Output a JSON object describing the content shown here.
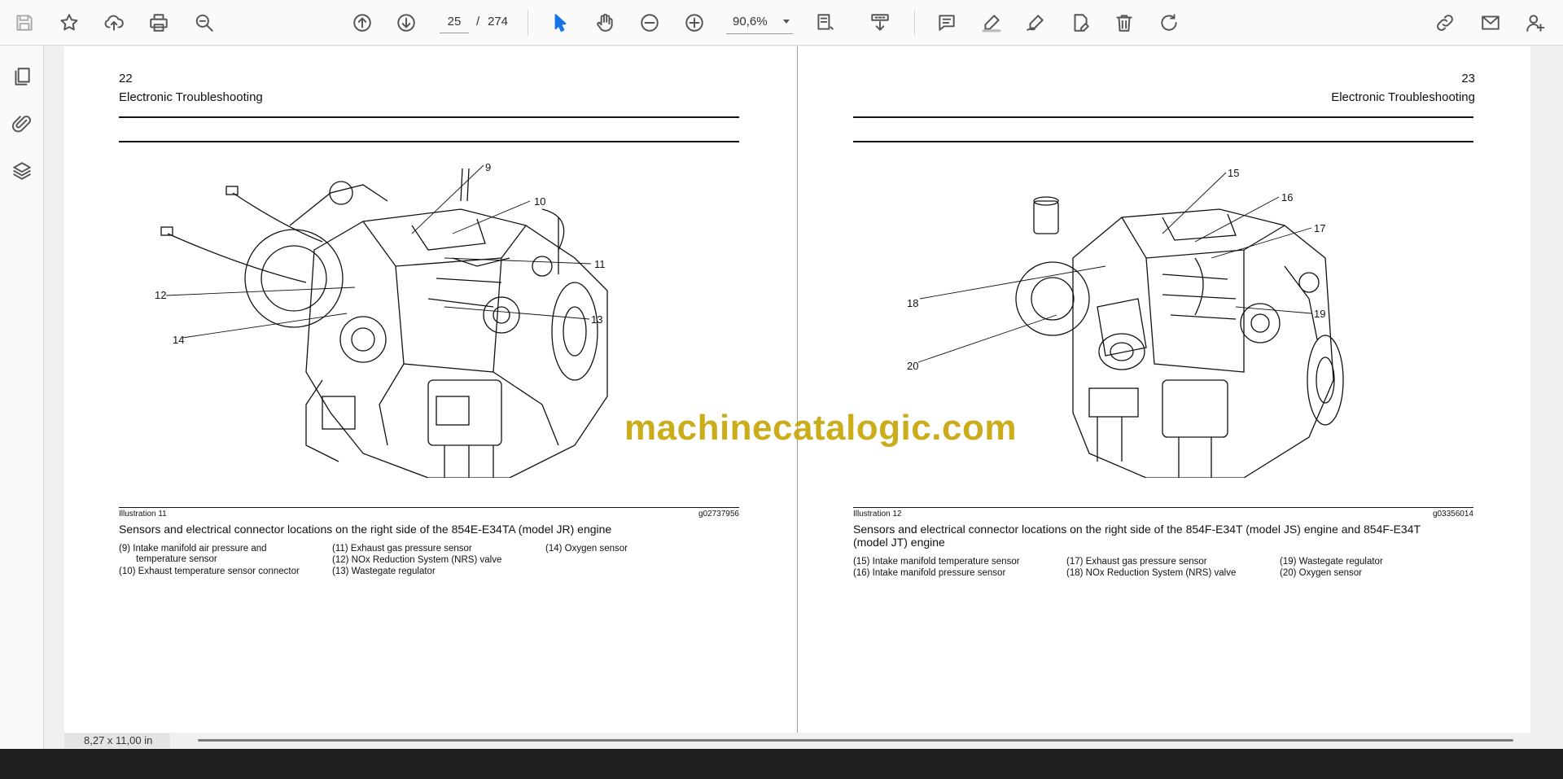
{
  "toolbar": {
    "page_current": "25",
    "page_separator": "/",
    "page_total": "274",
    "zoom": "90,6%",
    "icons": [
      "save-icon",
      "star-icon",
      "cloud-upload-icon",
      "print-icon",
      "zoom-search-icon",
      "page-up-icon",
      "page-down-icon",
      "select-cursor-icon",
      "hand-icon",
      "zoom-out-icon",
      "zoom-in-icon",
      "fit-page-icon",
      "scroll-mode-icon",
      "comment-icon",
      "highlight-pen-icon",
      "draw-icon",
      "edit-icon",
      "delete-icon",
      "rotate-icon",
      "share-link-icon",
      "email-icon",
      "add-user-icon"
    ],
    "accent_color": "#1473e6"
  },
  "sidebar": {
    "icons": [
      "pages-icon",
      "attachment-icon",
      "layers-icon"
    ]
  },
  "left_page": {
    "number": "22",
    "title": "Electronic Troubleshooting",
    "callouts": [
      "9",
      "10",
      "11",
      "12",
      "13",
      "14"
    ],
    "illustration_label": "Illustration 11",
    "illustration_code": "g02737956",
    "caption": "Sensors and electrical connector locations on the right side of the 854E-E34TA (model JR) engine",
    "legend": [
      {
        "line1": "(9) Intake manifold air pressure and",
        "line2": "temperature sensor"
      },
      {
        "line1": "(10) Exhaust temperature sensor connector"
      },
      {
        "line1": "(11) Exhaust gas pressure sensor"
      },
      {
        "line1": "(12) NOx Reduction System (NRS) valve"
      },
      {
        "line1": "(13) Wastegate regulator"
      },
      {
        "line1": "(14) Oxygen sensor"
      }
    ]
  },
  "right_page": {
    "number": "23",
    "title": "Electronic Troubleshooting",
    "callouts": [
      "15",
      "16",
      "17",
      "18",
      "19",
      "20"
    ],
    "illustration_label": "Illustration 12",
    "illustration_code": "g03356014",
    "caption_line1": "Sensors and electrical connector locations on the right side of the 854F-E34T (model JS) engine and 854F-E34T",
    "caption_line2": "(model JT) engine",
    "legend": [
      {
        "line1": "(15) Intake manifold temperature sensor"
      },
      {
        "line1": "(16) Intake manifold pressure sensor"
      },
      {
        "line1": "(17) Exhaust gas pressure sensor"
      },
      {
        "line1": "(18) NOx Reduction System (NRS) valve"
      },
      {
        "line1": "(19) Wastegate regulator"
      },
      {
        "line1": "(20) Oxygen sensor"
      }
    ]
  },
  "watermark": "machinecatalogic.com",
  "status": {
    "page_size": "8,27 x 11,00 in"
  }
}
